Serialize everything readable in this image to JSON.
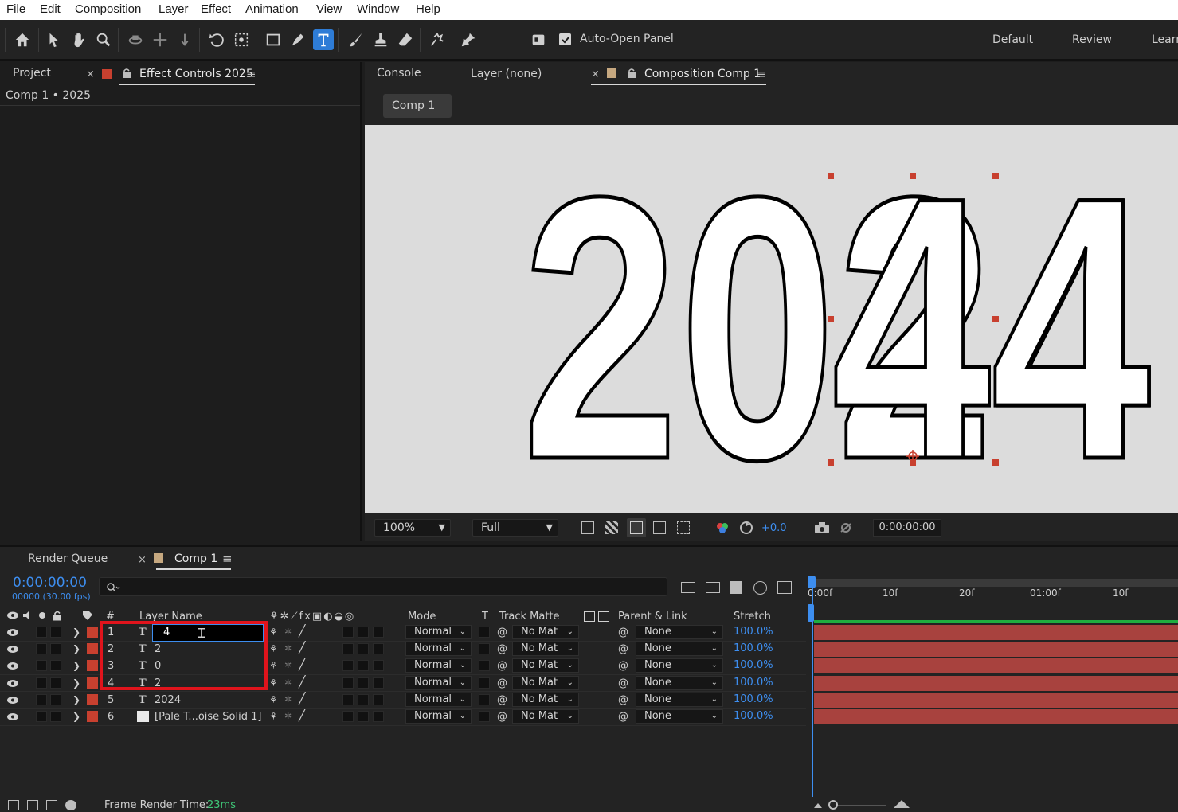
{
  "menu": [
    "File",
    "Edit",
    "Composition",
    "Layer",
    "Effect",
    "Animation",
    "View",
    "Window",
    "Help"
  ],
  "toolbar": {
    "auto_open_label": "Auto-Open Panel",
    "workspaces": [
      "Default",
      "Review",
      "Learn"
    ]
  },
  "left_panel": {
    "tab_project": "Project",
    "tab_effect_controls": "Effect Controls 2025",
    "breadcrumb": "Comp 1 • 2025"
  },
  "comp_panel": {
    "tab_console": "Console",
    "tab_layer": "Layer (none)",
    "tab_composition": "Composition Comp 1",
    "comp_chip": "Comp 1",
    "zoom": "100%",
    "resolution": "Full",
    "exposure": "+0.0",
    "timecode": "0:00:00:00",
    "canvas_text_back": "2024",
    "canvas_text_front": "44"
  },
  "timeline": {
    "tab_render_queue": "Render Queue",
    "tab_comp": "Comp 1",
    "current_time": "0:00:00:00",
    "frame_info": "00000 (30.00 fps)",
    "headers": {
      "num": "#",
      "layer_name": "Layer Name",
      "mode": "Mode",
      "t": "T",
      "track_matte": "Track Matte",
      "parent": "Parent & Link",
      "stretch": "Stretch"
    },
    "ruler": [
      "0:00f",
      "10f",
      "20f",
      "01:00f",
      "10f"
    ],
    "editing_value": "4",
    "layers": [
      {
        "num": "1",
        "type": "T",
        "name": "",
        "mode": "Normal",
        "matte": "No Mat",
        "parent": "None",
        "stretch": "100.0%"
      },
      {
        "num": "2",
        "type": "T",
        "name": "2",
        "mode": "Normal",
        "matte": "No Mat",
        "parent": "None",
        "stretch": "100.0%"
      },
      {
        "num": "3",
        "type": "T",
        "name": "0",
        "mode": "Normal",
        "matte": "No Mat",
        "parent": "None",
        "stretch": "100.0%"
      },
      {
        "num": "4",
        "type": "T",
        "name": "2",
        "mode": "Normal",
        "matte": "No Mat",
        "parent": "None",
        "stretch": "100.0%"
      },
      {
        "num": "5",
        "type": "T",
        "name": "2024",
        "mode": "Normal",
        "matte": "No Mat",
        "parent": "None",
        "stretch": "100.0%"
      },
      {
        "num": "6",
        "type": "",
        "name": "[Pale T...oise Solid 1]",
        "mode": "Normal",
        "matte": "No Mat",
        "parent": "None",
        "stretch": "100.0%"
      }
    ],
    "frame_render_label": "Frame Render Time:",
    "frame_render_value": "23ms"
  },
  "colors": {
    "accent_blue": "#2e7cd6",
    "label_red": "#c8402f",
    "track_bar": "#a8423e",
    "highlight_box": "#e0141c",
    "time_blue": "#3d8ef0"
  }
}
